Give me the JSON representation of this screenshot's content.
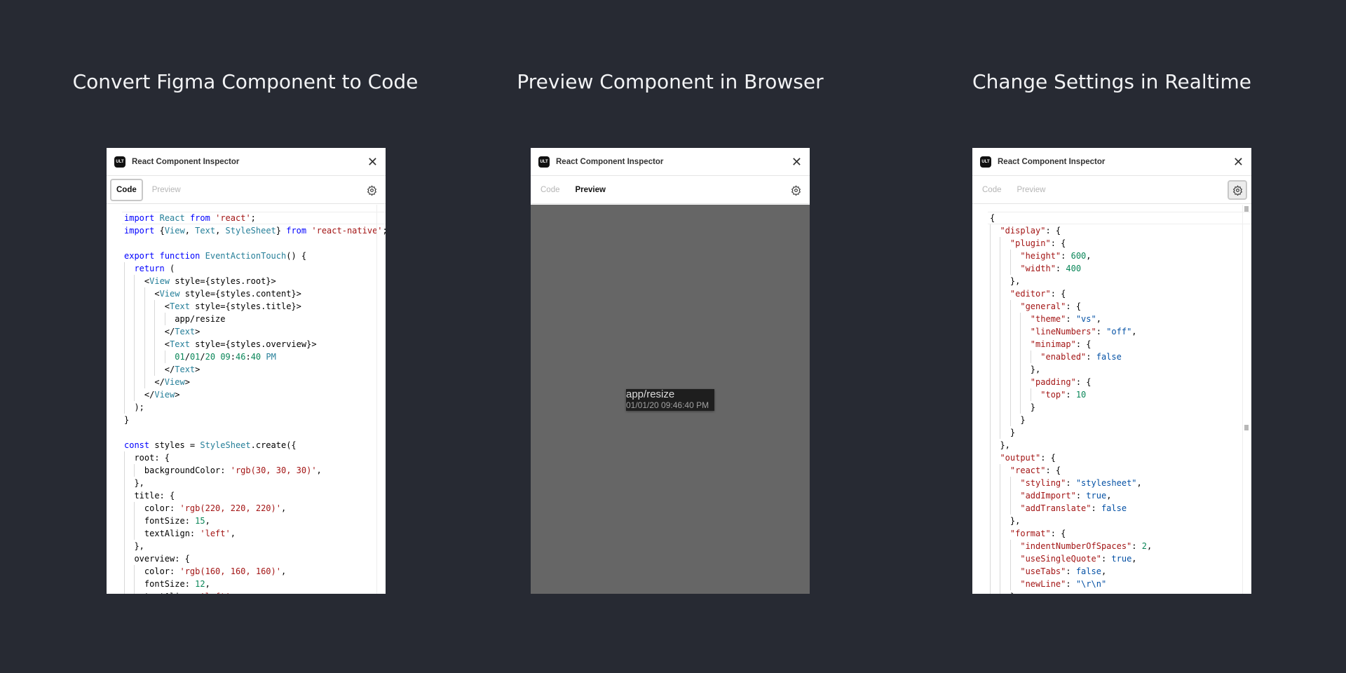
{
  "headings": [
    "Convert Figma Component to Code",
    "Preview Component in Browser",
    "Change Settings in Realtime"
  ],
  "window": {
    "title": "React Component Inspector",
    "logo": "ULT",
    "close_icon": "close-icon",
    "settings_icon": "gear-icon"
  },
  "tabs": {
    "code": "Code",
    "preview": "Preview"
  },
  "colors": {
    "background": "#272a33",
    "keyword": "#0000ff",
    "type": "#267f99",
    "string": "#a31515",
    "number": "#098658",
    "value": "#0451a5",
    "preview_bg": "#666666",
    "component_bg": "#1e1e1e"
  },
  "code_lines": [
    [
      0,
      [
        [
          "k",
          "import"
        ],
        [
          "p",
          " "
        ],
        [
          "t",
          "React"
        ],
        [
          "p",
          " "
        ],
        [
          "k",
          "from"
        ],
        [
          "p",
          " "
        ],
        [
          "s",
          "'react'"
        ],
        [
          "p",
          ";"
        ]
      ]
    ],
    [
      0,
      [
        [
          "k",
          "import"
        ],
        [
          "p",
          " {"
        ],
        [
          "t",
          "View"
        ],
        [
          "p",
          ", "
        ],
        [
          "t",
          "Text"
        ],
        [
          "p",
          ", "
        ],
        [
          "t",
          "StyleSheet"
        ],
        [
          "p",
          "} "
        ],
        [
          "k",
          "from"
        ],
        [
          "p",
          " "
        ],
        [
          "s",
          "'react-native'"
        ],
        [
          "p",
          ";"
        ]
      ]
    ],
    [
      0,
      []
    ],
    [
      0,
      [
        [
          "k",
          "export"
        ],
        [
          "p",
          " "
        ],
        [
          "k",
          "function"
        ],
        [
          "p",
          " "
        ],
        [
          "t",
          "EventActionTouch"
        ],
        [
          "p",
          "() {"
        ]
      ]
    ],
    [
      1,
      [
        [
          "k",
          "return"
        ],
        [
          "p",
          " ("
        ]
      ]
    ],
    [
      2,
      [
        [
          "p",
          "<"
        ],
        [
          "t",
          "View"
        ],
        [
          "p",
          " style={styles.root}>"
        ]
      ]
    ],
    [
      3,
      [
        [
          "p",
          "<"
        ],
        [
          "t",
          "View"
        ],
        [
          "p",
          " style={styles.content}>"
        ]
      ]
    ],
    [
      4,
      [
        [
          "p",
          "<"
        ],
        [
          "t",
          "Text"
        ],
        [
          "p",
          " style={styles.title}>"
        ]
      ]
    ],
    [
      5,
      [
        [
          "p",
          "app/resize"
        ]
      ]
    ],
    [
      4,
      [
        [
          "p",
          "</"
        ],
        [
          "t",
          "Text"
        ],
        [
          "p",
          ">"
        ]
      ]
    ],
    [
      4,
      [
        [
          "p",
          "<"
        ],
        [
          "t",
          "Text"
        ],
        [
          "p",
          " style={styles.overview}>"
        ]
      ]
    ],
    [
      5,
      [
        [
          "n",
          "01"
        ],
        [
          "p",
          "/"
        ],
        [
          "n",
          "01"
        ],
        [
          "p",
          "/"
        ],
        [
          "n",
          "20"
        ],
        [
          "p",
          " "
        ],
        [
          "n",
          "09"
        ],
        [
          "p",
          ":"
        ],
        [
          "n",
          "46"
        ],
        [
          "p",
          ":"
        ],
        [
          "n",
          "40"
        ],
        [
          "p",
          " "
        ],
        [
          "t",
          "PM"
        ]
      ]
    ],
    [
      4,
      [
        [
          "p",
          "</"
        ],
        [
          "t",
          "Text"
        ],
        [
          "p",
          ">"
        ]
      ]
    ],
    [
      3,
      [
        [
          "p",
          "</"
        ],
        [
          "t",
          "View"
        ],
        [
          "p",
          ">"
        ]
      ]
    ],
    [
      2,
      [
        [
          "p",
          "</"
        ],
        [
          "t",
          "View"
        ],
        [
          "p",
          ">"
        ]
      ]
    ],
    [
      1,
      [
        [
          "p",
          ");"
        ]
      ]
    ],
    [
      0,
      [
        [
          "p",
          "}"
        ]
      ]
    ],
    [
      0,
      []
    ],
    [
      0,
      [
        [
          "k",
          "const"
        ],
        [
          "p",
          " styles = "
        ],
        [
          "t",
          "StyleSheet"
        ],
        [
          "p",
          ".create({"
        ]
      ]
    ],
    [
      1,
      [
        [
          "p",
          "root: {"
        ]
      ]
    ],
    [
      2,
      [
        [
          "p",
          "backgroundColor: "
        ],
        [
          "s",
          "'rgb(30, 30, 30)'"
        ],
        [
          "p",
          ","
        ]
      ]
    ],
    [
      1,
      [
        [
          "p",
          "},"
        ]
      ]
    ],
    [
      1,
      [
        [
          "p",
          "title: {"
        ]
      ]
    ],
    [
      2,
      [
        [
          "p",
          "color: "
        ],
        [
          "s",
          "'rgb(220, 220, 220)'"
        ],
        [
          "p",
          ","
        ]
      ]
    ],
    [
      2,
      [
        [
          "p",
          "fontSize: "
        ],
        [
          "n",
          "15"
        ],
        [
          "p",
          ","
        ]
      ]
    ],
    [
      2,
      [
        [
          "p",
          "textAlign: "
        ],
        [
          "s",
          "'left'"
        ],
        [
          "p",
          ","
        ]
      ]
    ],
    [
      1,
      [
        [
          "p",
          "},"
        ]
      ]
    ],
    [
      1,
      [
        [
          "p",
          "overview: {"
        ]
      ]
    ],
    [
      2,
      [
        [
          "p",
          "color: "
        ],
        [
          "s",
          "'rgb(160, 160, 160)'"
        ],
        [
          "p",
          ","
        ]
      ]
    ],
    [
      2,
      [
        [
          "p",
          "fontSize: "
        ],
        [
          "n",
          "12"
        ],
        [
          "p",
          ","
        ]
      ]
    ],
    [
      2,
      [
        [
          "p",
          "textAlign: "
        ],
        [
          "s",
          "'left'"
        ],
        [
          "p",
          ","
        ]
      ]
    ]
  ],
  "preview": {
    "title": "app/resize",
    "overview": "01/01/20 09:46:40 PM"
  },
  "settings_lines": [
    [
      0,
      [
        [
          "p",
          "{"
        ]
      ]
    ],
    [
      1,
      [
        [
          "s",
          "\"display\""
        ],
        [
          "p",
          ": {"
        ]
      ]
    ],
    [
      2,
      [
        [
          "s",
          "\"plugin\""
        ],
        [
          "p",
          ": {"
        ]
      ]
    ],
    [
      3,
      [
        [
          "s",
          "\"height\""
        ],
        [
          "p",
          ": "
        ],
        [
          "n",
          "600"
        ],
        [
          "p",
          ","
        ]
      ]
    ],
    [
      3,
      [
        [
          "s",
          "\"width\""
        ],
        [
          "p",
          ": "
        ],
        [
          "n",
          "400"
        ]
      ]
    ],
    [
      2,
      [
        [
          "p",
          "},"
        ]
      ]
    ],
    [
      2,
      [
        [
          "s",
          "\"editor\""
        ],
        [
          "p",
          ": {"
        ]
      ]
    ],
    [
      3,
      [
        [
          "s",
          "\"general\""
        ],
        [
          "p",
          ": {"
        ]
      ]
    ],
    [
      4,
      [
        [
          "s",
          "\"theme\""
        ],
        [
          "p",
          ": "
        ],
        [
          "b",
          "\"vs\""
        ],
        [
          "p",
          ","
        ]
      ]
    ],
    [
      4,
      [
        [
          "s",
          "\"lineNumbers\""
        ],
        [
          "p",
          ": "
        ],
        [
          "b",
          "\"off\""
        ],
        [
          "p",
          ","
        ]
      ]
    ],
    [
      4,
      [
        [
          "s",
          "\"minimap\""
        ],
        [
          "p",
          ": {"
        ]
      ]
    ],
    [
      5,
      [
        [
          "s",
          "\"enabled\""
        ],
        [
          "p",
          ": "
        ],
        [
          "b",
          "false"
        ]
      ]
    ],
    [
      4,
      [
        [
          "p",
          "},"
        ]
      ]
    ],
    [
      4,
      [
        [
          "s",
          "\"padding\""
        ],
        [
          "p",
          ": {"
        ]
      ]
    ],
    [
      5,
      [
        [
          "s",
          "\"top\""
        ],
        [
          "p",
          ": "
        ],
        [
          "n",
          "10"
        ]
      ]
    ],
    [
      4,
      [
        [
          "p",
          "}"
        ]
      ]
    ],
    [
      3,
      [
        [
          "p",
          "}"
        ]
      ]
    ],
    [
      2,
      [
        [
          "p",
          "}"
        ]
      ]
    ],
    [
      1,
      [
        [
          "p",
          "},"
        ]
      ]
    ],
    [
      1,
      [
        [
          "s",
          "\"output\""
        ],
        [
          "p",
          ": {"
        ]
      ]
    ],
    [
      2,
      [
        [
          "s",
          "\"react\""
        ],
        [
          "p",
          ": {"
        ]
      ]
    ],
    [
      3,
      [
        [
          "s",
          "\"styling\""
        ],
        [
          "p",
          ": "
        ],
        [
          "b",
          "\"stylesheet\""
        ],
        [
          "p",
          ","
        ]
      ]
    ],
    [
      3,
      [
        [
          "s",
          "\"addImport\""
        ],
        [
          "p",
          ": "
        ],
        [
          "b",
          "true"
        ],
        [
          "p",
          ","
        ]
      ]
    ],
    [
      3,
      [
        [
          "s",
          "\"addTranslate\""
        ],
        [
          "p",
          ": "
        ],
        [
          "b",
          "false"
        ]
      ]
    ],
    [
      2,
      [
        [
          "p",
          "},"
        ]
      ]
    ],
    [
      2,
      [
        [
          "s",
          "\"format\""
        ],
        [
          "p",
          ": {"
        ]
      ]
    ],
    [
      3,
      [
        [
          "s",
          "\"indentNumberOfSpaces\""
        ],
        [
          "p",
          ": "
        ],
        [
          "n",
          "2"
        ],
        [
          "p",
          ","
        ]
      ]
    ],
    [
      3,
      [
        [
          "s",
          "\"useSingleQuote\""
        ],
        [
          "p",
          ": "
        ],
        [
          "b",
          "true"
        ],
        [
          "p",
          ","
        ]
      ]
    ],
    [
      3,
      [
        [
          "s",
          "\"useTabs\""
        ],
        [
          "p",
          ": "
        ],
        [
          "b",
          "false"
        ],
        [
          "p",
          ","
        ]
      ]
    ],
    [
      3,
      [
        [
          "s",
          "\"newLine\""
        ],
        [
          "p",
          ": "
        ],
        [
          "b",
          "\"\\r\\n\""
        ]
      ]
    ],
    [
      2,
      [
        [
          "p",
          "}"
        ]
      ]
    ]
  ]
}
